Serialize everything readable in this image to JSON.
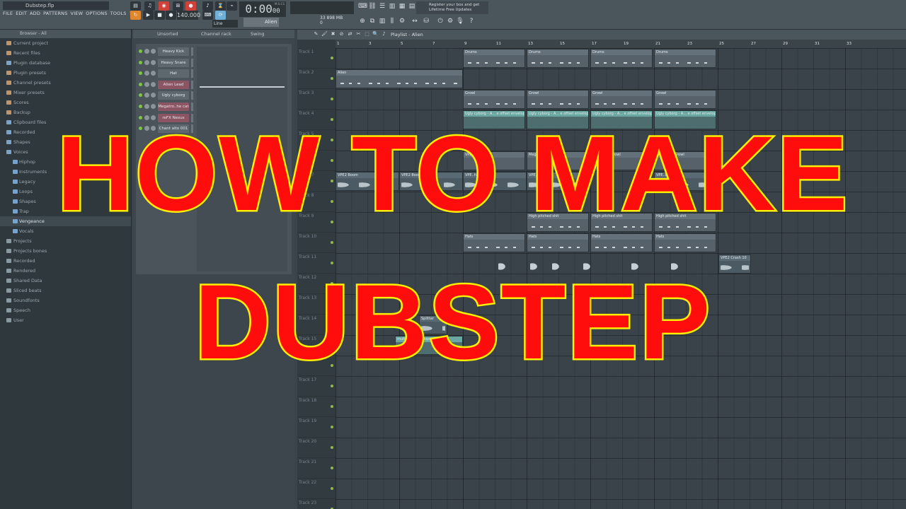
{
  "window": {
    "title": "Dubstep.flp"
  },
  "menu": [
    "FILE",
    "EDIT",
    "ADD",
    "PATTERNS",
    "VIEW",
    "OPTIONS",
    "TOOLS",
    "?"
  ],
  "transport": {
    "tempo": "140.000",
    "time_main": "0:00",
    "time_sub": "00",
    "time_unit": "M:S:CS",
    "pattern": "Alien",
    "snap": "Line",
    "cpu": "33 898 MB",
    "cpu2": "0",
    "news_line1": "Register your box and get",
    "news_line2": "Lifetime Free Updates"
  },
  "browser": {
    "header": "Browser - All",
    "items": [
      {
        "label": "Current project",
        "tone": "warm"
      },
      {
        "label": "Recent files",
        "tone": "warm"
      },
      {
        "label": "Plugin database",
        "tone": "blue"
      },
      {
        "label": "Plugin presets",
        "tone": "warm"
      },
      {
        "label": "Channel presets",
        "tone": "warm"
      },
      {
        "label": "Mixer presets",
        "tone": "warm"
      },
      {
        "label": "Scores",
        "tone": "warm"
      },
      {
        "label": "Backup",
        "tone": "warm"
      },
      {
        "label": "Clipboard files",
        "tone": "blue"
      },
      {
        "label": "Recorded",
        "tone": "blue"
      },
      {
        "label": "Shapes",
        "tone": "blue"
      },
      {
        "label": "Voices",
        "tone": "blue"
      }
    ],
    "sub_items": [
      {
        "label": "Hiphop"
      },
      {
        "label": "Instruments"
      },
      {
        "label": "Legacy"
      },
      {
        "label": "Loops"
      },
      {
        "label": "Shapes"
      },
      {
        "label": "Trap"
      },
      {
        "label": "Vengeance",
        "selected": true
      },
      {
        "label": "Vocals"
      }
    ],
    "bottom_items": [
      {
        "label": "Projects"
      },
      {
        "label": "Projects bones"
      },
      {
        "label": "Recorded"
      },
      {
        "label": "Rendered"
      },
      {
        "label": "Shared Data"
      },
      {
        "label": "Sliced beats"
      },
      {
        "label": "Soundfonts"
      },
      {
        "label": "Speech"
      },
      {
        "label": "User"
      }
    ]
  },
  "channel_rack": {
    "title": "Channel rack",
    "filter": "Unsorted",
    "swing": "Swing",
    "channels": [
      {
        "name": "Heavy Kick",
        "pink": false
      },
      {
        "name": "Heavy Snare",
        "pink": false
      },
      {
        "name": "Hat",
        "pink": false
      },
      {
        "name": "Alien Lead",
        "pink": true
      },
      {
        "name": "Ugly cyborg",
        "pink": false
      },
      {
        "name": "Megatro..he cat",
        "pink": true
      },
      {
        "name": "reFX Nexus",
        "pink": true
      },
      {
        "name": "Chant alto 001",
        "pink": false
      }
    ]
  },
  "playlist": {
    "title": "Playlist - Alien",
    "bars": [
      "1",
      "3",
      "5",
      "7",
      "9",
      "11",
      "13",
      "15",
      "17",
      "19",
      "21",
      "23",
      "25",
      "27",
      "29",
      "31",
      "33"
    ],
    "tracks": [
      "Track 1",
      "Track 2",
      "Track 3",
      "Track 4",
      "Track 5",
      "Track 6",
      "Track 7",
      "Track 8",
      "Track 9",
      "Track 10",
      "Track 11",
      "Track 12",
      "Track 13",
      "Track 14",
      "Track 15",
      "Track 16",
      "Track 17",
      "Track 18",
      "Track 19",
      "Track 20",
      "Track 21",
      "Track 22",
      "Track 23"
    ],
    "clips": {
      "drums": "Drums",
      "alien": "Alien",
      "growl": "Growl",
      "ugly": "Ugly cyborg - A... e offset envelope",
      "megatron": "Megatron Growl",
      "vpe_boom": "VPE2 Boom",
      "vpe_h": "VPE..h 15",
      "high": "High pitched shit",
      "hats": "Hats",
      "crash": "VPE2 Crash 10",
      "splitter": "Splitter",
      "multiplier": "multiplier envelope"
    }
  },
  "overlay": {
    "line1": "HOW TO MAKE",
    "line2": "DUBSTEP"
  }
}
